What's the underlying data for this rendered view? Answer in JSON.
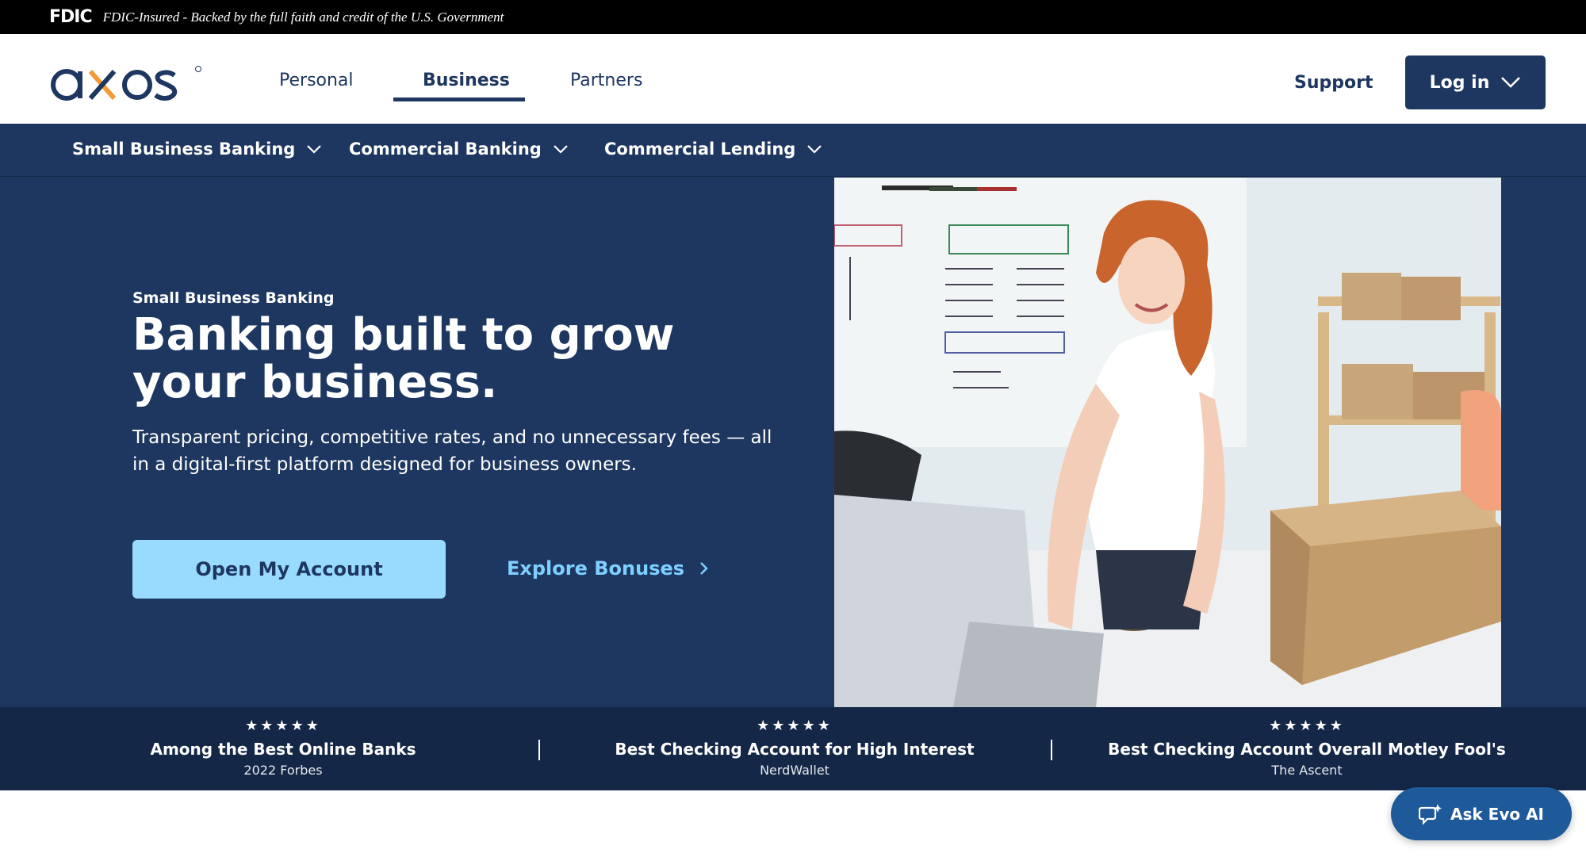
{
  "fdic": {
    "logo": "FDIC",
    "notice": "FDIC-Insured - Backed by the full faith and credit of the U.S. Government"
  },
  "header": {
    "brand": "axos",
    "tabs": [
      {
        "label": "Personal",
        "active": false
      },
      {
        "label": "Business",
        "active": true
      },
      {
        "label": "Partners",
        "active": false
      }
    ],
    "support": "Support",
    "login": "Log in"
  },
  "subnav": {
    "items": [
      {
        "label": "Small Business Banking"
      },
      {
        "label": "Commercial Banking"
      },
      {
        "label": "Commercial Lending"
      }
    ]
  },
  "hero": {
    "eyebrow": "Small Business Banking",
    "headline": "Banking built to grow your business.",
    "subtext": "Transparent pricing, competitive rates, and no unnecessary fees — all in a digital-first platform designed for business owners.",
    "primary_cta": "Open My Account",
    "secondary_cta": "Explore Bonuses"
  },
  "awards": [
    {
      "stars": "★★★★★",
      "title": "Among the Best Online Banks",
      "source": "2022 Forbes"
    },
    {
      "stars": "★★★★★",
      "title": "Best Checking Account for High Interest",
      "source": "NerdWallet"
    },
    {
      "stars": "★★★★★",
      "title": "Best Checking Account Overall Motley Fool's",
      "source": "The Ascent"
    }
  ],
  "chat": {
    "label": "Ask Evo AI"
  },
  "colors": {
    "navy": "#1e3760",
    "dark_band": "#152747",
    "cta_light_blue": "#99daff",
    "link_blue": "#7dd0ff",
    "logo_orange": "#f39a38"
  }
}
